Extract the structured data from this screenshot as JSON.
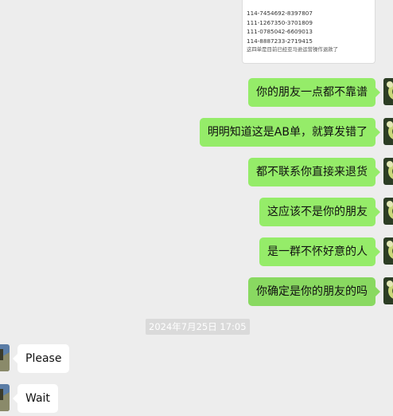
{
  "screenshot_card": {
    "lines": [
      "114-7454692-8397807",
      "111-1267350-3701809",
      "111-0785042-6609013",
      "114-8887233-2719415"
    ],
    "note": "这四单是目前已经亚马逊运营操作退款了"
  },
  "messages": [
    {
      "direction": "outgoing",
      "text": "你的朋友一点都不靠谱"
    },
    {
      "direction": "outgoing",
      "text": "明明知道这是AB单，就算发错了"
    },
    {
      "direction": "outgoing",
      "text": "都不联系你直接来退货"
    },
    {
      "direction": "outgoing",
      "text": "这应该不是你的朋友"
    },
    {
      "direction": "outgoing",
      "text": "是一群不怀好意的人"
    },
    {
      "direction": "outgoing",
      "text": "你确定是你的朋友的吗"
    }
  ],
  "timestamp": "2024年7月25日 17:05",
  "incoming": [
    {
      "direction": "incoming",
      "text": "Please"
    },
    {
      "direction": "incoming",
      "text": "Wait"
    }
  ],
  "colors": {
    "background": "#ededed",
    "outgoing_bubble": "#95ec69",
    "incoming_bubble": "#ffffff"
  }
}
